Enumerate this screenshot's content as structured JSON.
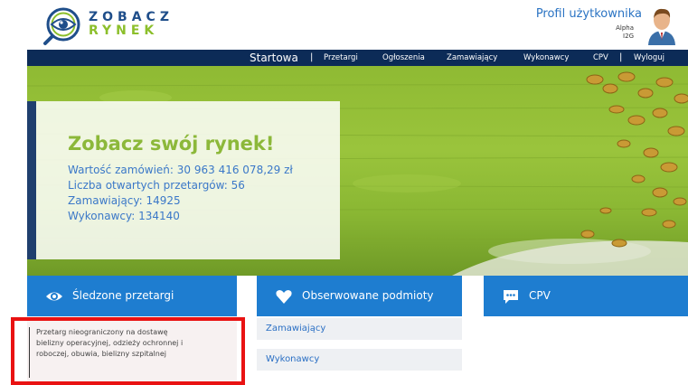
{
  "header": {
    "logo_line_1": "ZOBACZ",
    "logo_line_2": "RYNEK",
    "profile_link": "Profil użytkownika",
    "profile_name_line_1": "Alpha",
    "profile_name_line_2": "I2G"
  },
  "nav": {
    "items": [
      {
        "label": "Startowa"
      },
      {
        "label": "Przetargi"
      },
      {
        "label": "Ogłoszenia"
      },
      {
        "label": "Zamawiający"
      },
      {
        "label": "Wykonawcy"
      },
      {
        "label": "CPV"
      },
      {
        "label": "Wyloguj"
      }
    ],
    "separator": "|"
  },
  "hero": {
    "title": "Zobacz swój rynek!",
    "lines": [
      "Wartość zamówień: 30 963 416 078,29 zł",
      "Liczba otwartych przetargów: 56",
      "Zamawiający: 14925",
      "Wykonawcy: 134140"
    ]
  },
  "boxes": {
    "tracked": {
      "title": "Śledzone przetargi",
      "icon": "eye-icon",
      "entry_lines": [
        "Przetarg nieograniczony na dostawę",
        "bielizny operacyjnej, odzieży ochronnej i",
        "roboczej, obuwia, bielizny szpitalnej"
      ]
    },
    "observed": {
      "title": "Obserwowane podmioty",
      "icon": "heart-icon",
      "items": [
        "Zamawiający",
        "Wykonawcy"
      ]
    },
    "cpv": {
      "title": "CPV",
      "icon": "chat-icon"
    }
  },
  "colors": {
    "nav_bg": "#0c2b57",
    "box_header": "#1e7dd0",
    "accent_green": "#8cb83a",
    "link_blue": "#3b78c8",
    "highlight": "#e91212"
  }
}
